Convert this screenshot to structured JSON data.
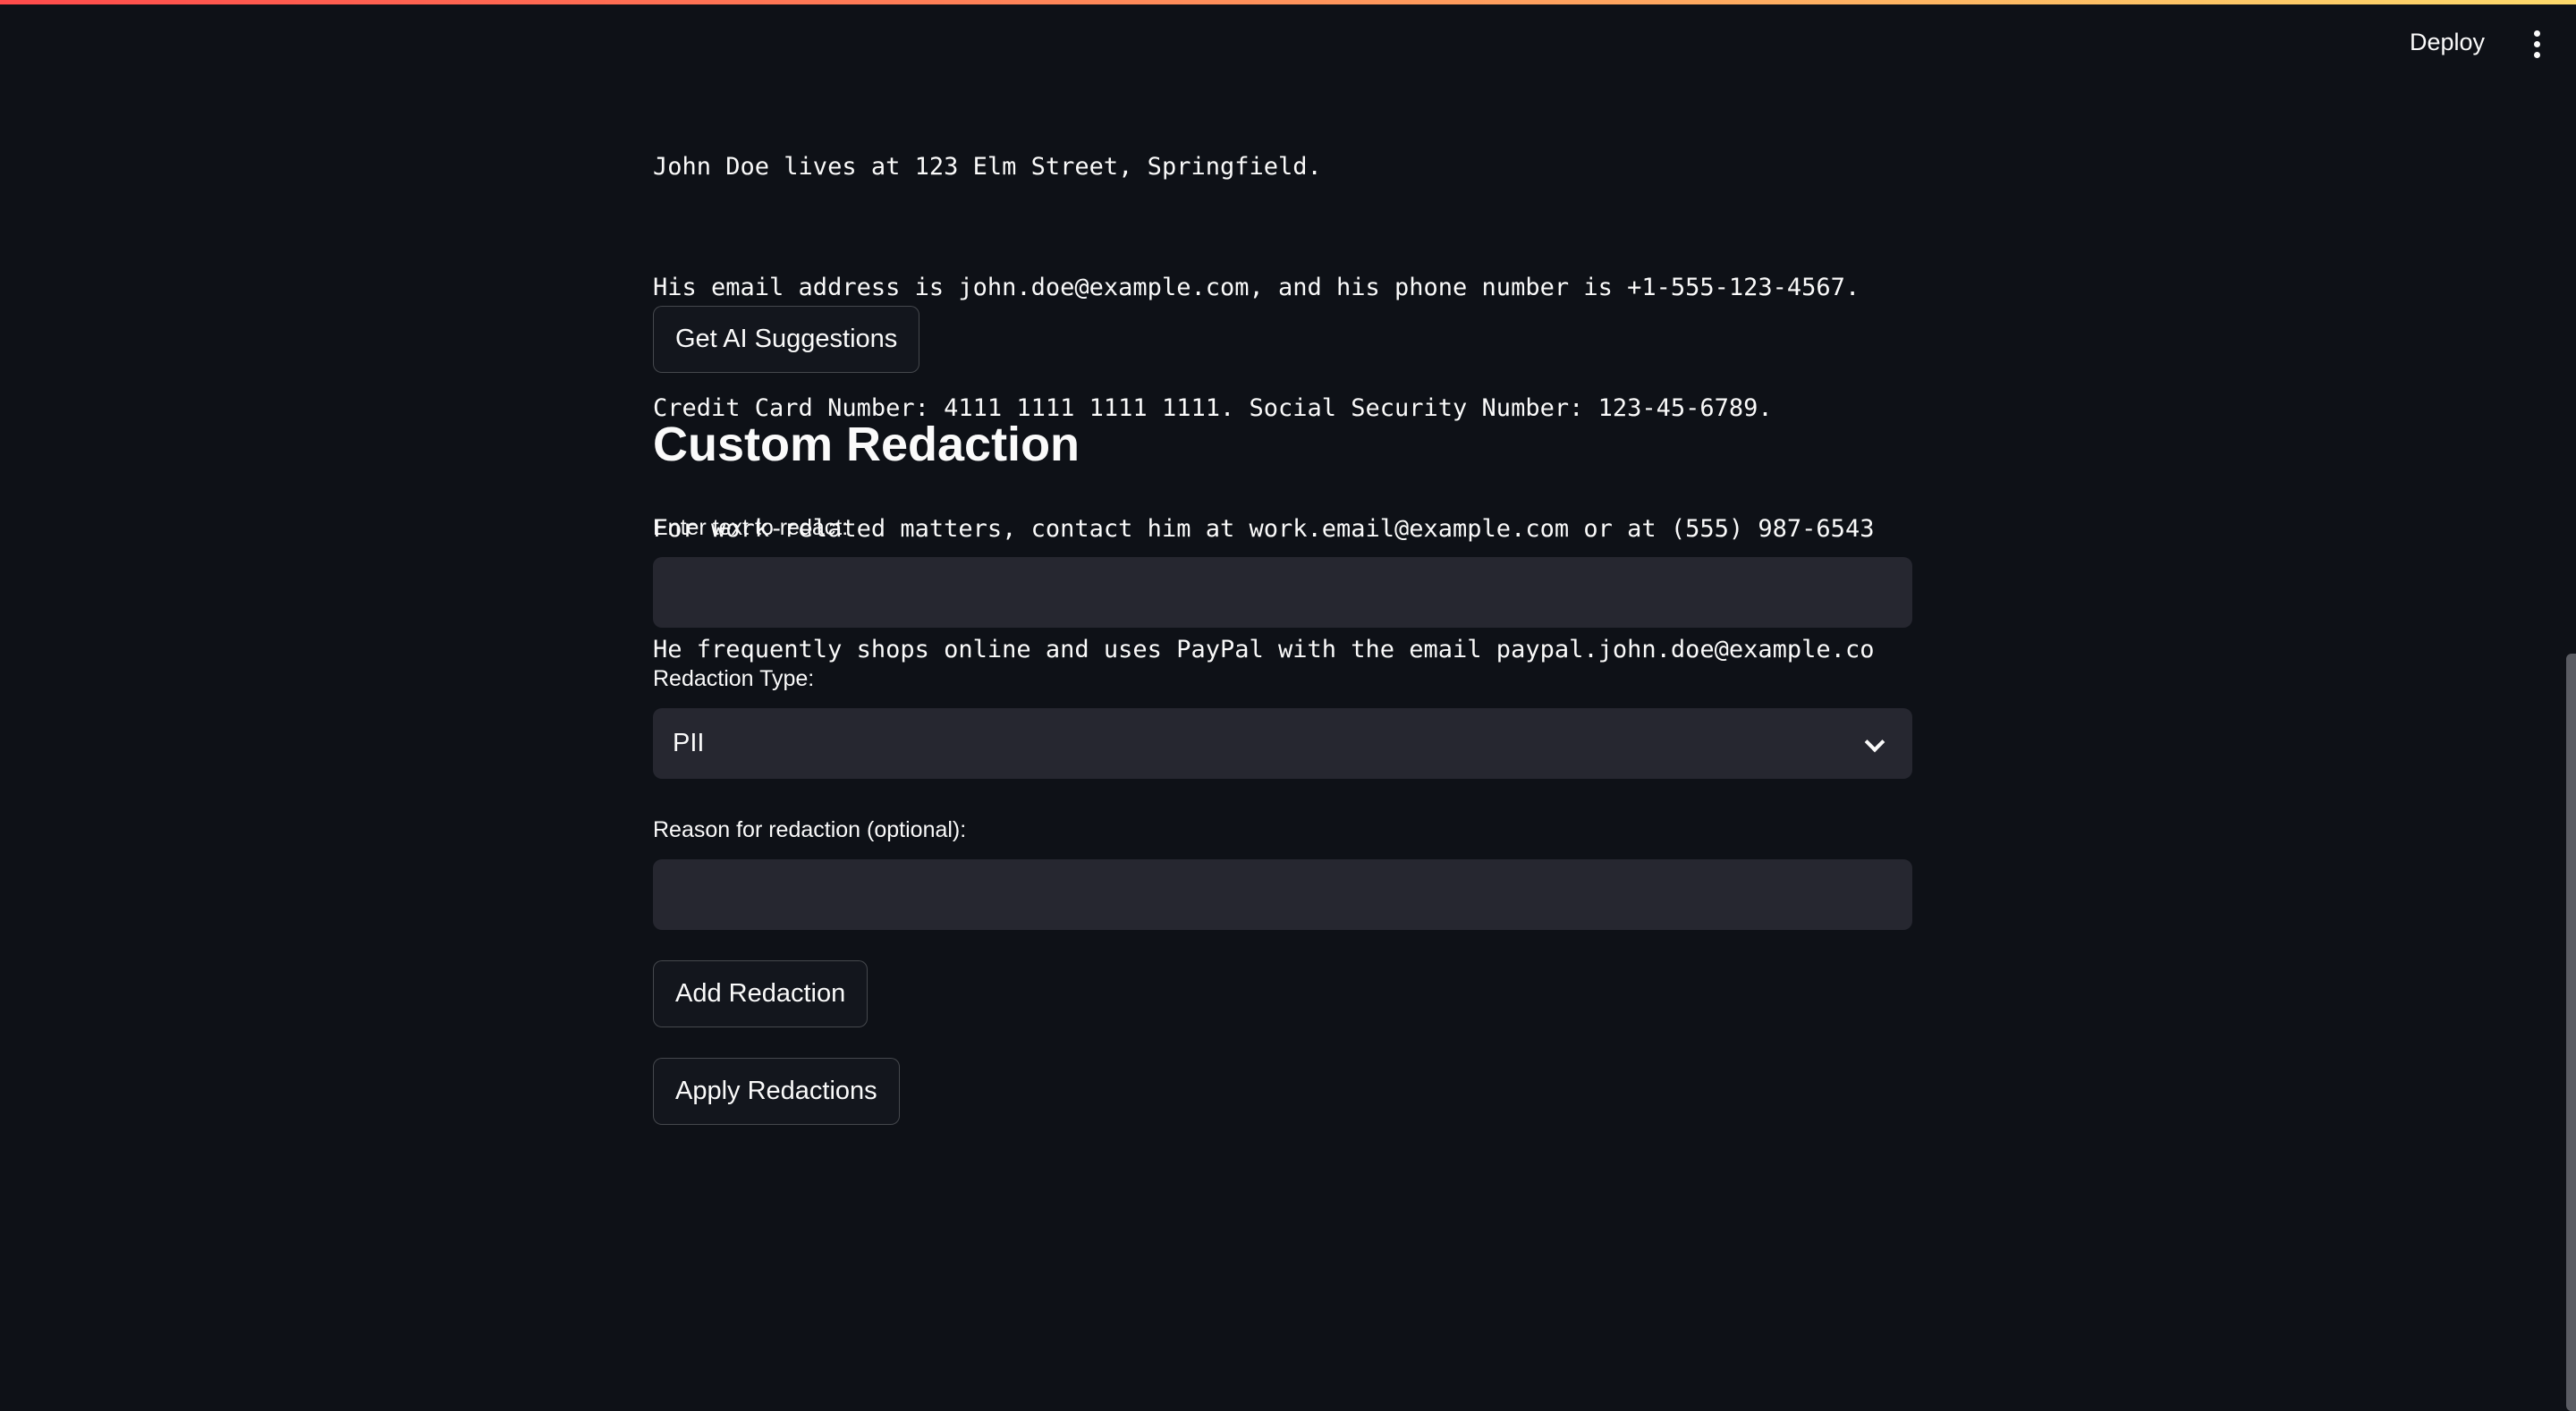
{
  "header": {
    "deploy_label": "Deploy",
    "menu_icon": "vertical-ellipsis-icon"
  },
  "document_text": [
    "John Doe lives at 123 Elm Street, Springfield.",
    "His email address is john.doe@example.com, and his phone number is +1-555-123-4567.",
    "Credit Card Number: 4111 1111 1111 1111. Social Security Number: 123-45-6789.",
    "For work-related matters, contact him at work.email@example.com or at (555) 987-6543",
    "He frequently shops online and uses PayPal with the email paypal.john.doe@example.co"
  ],
  "ai_button_label": "Get AI Suggestions",
  "custom": {
    "title": "Custom Redaction",
    "text_label": "Enter text to redact:",
    "text_value": "",
    "type_label": "Redaction Type:",
    "type_value": "PII",
    "reason_label": "Reason for redaction (optional):",
    "reason_value": "",
    "add_label": "Add Redaction",
    "apply_label": "Apply Redactions"
  },
  "colors": {
    "background": "#0e1117",
    "input": "#262730",
    "accent_start": "#ff4b4b",
    "accent_end": "#fdda6b"
  }
}
